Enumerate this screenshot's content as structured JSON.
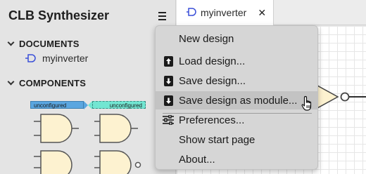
{
  "app": {
    "title": "CLB Synthesizer"
  },
  "sidebar": {
    "menu_icon": "hamburger-icon",
    "documents": {
      "header": "DOCUMENTS",
      "items": [
        {
          "label": "myinverter",
          "icon": "gate-doc-icon"
        }
      ]
    },
    "components": {
      "header": "COMPONENTS",
      "chips": [
        {
          "label": "unconfigured",
          "color": "#5aa6e0"
        },
        {
          "label": "unconfigured",
          "color": "#72e6d2"
        }
      ]
    }
  },
  "tabs": [
    {
      "label": "myinverter",
      "icon": "gate-doc-icon",
      "close": "✕"
    }
  ],
  "menu": {
    "items": [
      {
        "label": "New design",
        "icon": ""
      },
      {
        "label": "Load design...",
        "icon": "upload-icon"
      },
      {
        "label": "Save design...",
        "icon": "download-icon"
      },
      {
        "label": "Save design as module...",
        "icon": "download-icon"
      },
      {
        "label": "Preferences...",
        "icon": "sliders-icon"
      },
      {
        "label": "Show start page",
        "icon": ""
      },
      {
        "label": "About...",
        "icon": ""
      }
    ],
    "hovered_index": 3
  },
  "colors": {
    "gate_fill": "#fdf2d0",
    "gate_stroke": "#555555",
    "doc_icon": "#3a4fd8"
  }
}
